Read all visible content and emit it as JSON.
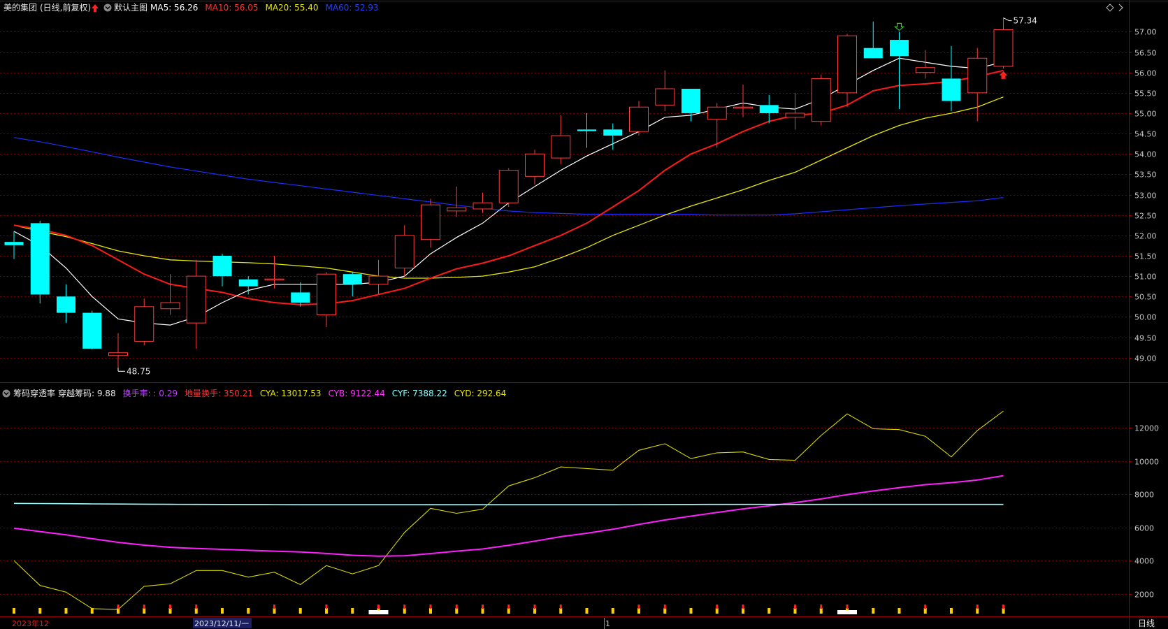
{
  "header": {
    "stock_name": "美的集团",
    "period": "(日线,前复权)",
    "template": "默认主图",
    "ma_items": [
      {
        "label": "MA5: 56.26",
        "color": "#ffffff"
      },
      {
        "label": "MA10: 56.05",
        "color": "#ff3030"
      },
      {
        "label": "MA20: 55.40",
        "color": "#e8e800"
      },
      {
        "label": "MA60: 52.93",
        "color": "#2040ff"
      }
    ]
  },
  "indicator_header": {
    "name": "筹码穿透率",
    "items": [
      {
        "label": "穿越筹码: 9.88",
        "color": "#e8e8e8"
      },
      {
        "label": "换手率: : 0.29",
        "color": "#c040ff"
      },
      {
        "label": "地量换手: 350.21",
        "color": "#ff3030"
      },
      {
        "label": "CYA: 13017.53",
        "color": "#e8e800"
      },
      {
        "label": "CYB: 9122.44",
        "color": "#ff30ff"
      },
      {
        "label": "CYF: 7388.22",
        "color": "#80ffff"
      },
      {
        "label": "CYD: 292.64",
        "color": "#e8e800"
      }
    ]
  },
  "bottom_axis": {
    "labels": [
      "2023年12",
      "2023/12/11/一",
      "1"
    ],
    "period_button": "日线"
  },
  "colors": {
    "up": "#ff3b3b",
    "down": "#00ffff",
    "ma5": "#ffffff",
    "ma10": "#ff1a1a",
    "ma20": "#e8e800",
    "ma60": "#1a2fff",
    "grid": "#7a0000",
    "cya": "#d8d800",
    "cyb": "#ff20ff",
    "cyf": "#a0ffff"
  },
  "chart_data": [
    {
      "type": "candlestick",
      "ylim": [
        48.6,
        57.35
      ],
      "yticks": [
        49.0,
        49.5,
        50.0,
        50.5,
        51.0,
        51.5,
        52.0,
        52.5,
        53.0,
        53.5,
        54.0,
        54.5,
        55.0,
        55.5,
        56.0,
        56.5,
        57.0
      ],
      "candles": [
        {
          "o": 51.84,
          "h": 52.1,
          "l": 51.42,
          "c": 51.76
        },
        {
          "o": 52.3,
          "h": 52.36,
          "l": 50.33,
          "c": 50.55
        },
        {
          "o": 50.5,
          "h": 50.8,
          "l": 49.85,
          "c": 50.1
        },
        {
          "o": 50.1,
          "h": 50.15,
          "l": 49.2,
          "c": 49.22
        },
        {
          "o": 49.05,
          "h": 49.6,
          "l": 48.75,
          "c": 49.12
        },
        {
          "o": 49.4,
          "h": 50.45,
          "l": 49.3,
          "c": 50.25
        },
        {
          "o": 50.2,
          "h": 51.05,
          "l": 50.05,
          "c": 50.35
        },
        {
          "o": 49.85,
          "h": 51.4,
          "l": 49.22,
          "c": 51.0
        },
        {
          "o": 51.5,
          "h": 51.55,
          "l": 50.75,
          "c": 51.0
        },
        {
          "o": 50.92,
          "h": 51.0,
          "l": 50.55,
          "c": 50.75
        },
        {
          "o": 50.93,
          "h": 51.5,
          "l": 50.7,
          "c": 50.93
        },
        {
          "o": 50.6,
          "h": 50.85,
          "l": 50.25,
          "c": 50.35
        },
        {
          "o": 50.05,
          "h": 51.1,
          "l": 49.75,
          "c": 51.05
        },
        {
          "o": 51.05,
          "h": 51.1,
          "l": 50.5,
          "c": 50.8
        },
        {
          "o": 50.8,
          "h": 51.4,
          "l": 50.55,
          "c": 51.0
        },
        {
          "o": 51.2,
          "h": 52.25,
          "l": 51.0,
          "c": 52.0
        },
        {
          "o": 51.9,
          "h": 52.9,
          "l": 51.7,
          "c": 52.75
        },
        {
          "o": 52.6,
          "h": 53.2,
          "l": 52.45,
          "c": 52.68
        },
        {
          "o": 52.65,
          "h": 53.05,
          "l": 52.55,
          "c": 52.8
        },
        {
          "o": 52.8,
          "h": 53.65,
          "l": 52.7,
          "c": 53.6
        },
        {
          "o": 53.45,
          "h": 54.1,
          "l": 53.25,
          "c": 54.0
        },
        {
          "o": 53.9,
          "h": 54.95,
          "l": 53.75,
          "c": 54.45
        },
        {
          "o": 54.6,
          "h": 55.0,
          "l": 54.15,
          "c": 54.56
        },
        {
          "o": 54.6,
          "h": 54.75,
          "l": 54.1,
          "c": 54.45
        },
        {
          "o": 54.55,
          "h": 55.3,
          "l": 54.45,
          "c": 55.15
        },
        {
          "o": 55.2,
          "h": 56.05,
          "l": 55.05,
          "c": 55.6
        },
        {
          "o": 55.6,
          "h": 55.6,
          "l": 54.8,
          "c": 55.0
        },
        {
          "o": 54.85,
          "h": 55.25,
          "l": 54.15,
          "c": 55.15
        },
        {
          "o": 55.15,
          "h": 55.7,
          "l": 54.9,
          "c": 55.15
        },
        {
          "o": 55.2,
          "h": 55.45,
          "l": 54.75,
          "c": 55.0
        },
        {
          "o": 54.9,
          "h": 55.5,
          "l": 54.6,
          "c": 55.0
        },
        {
          "o": 54.8,
          "h": 55.95,
          "l": 54.7,
          "c": 55.85
        },
        {
          "o": 55.5,
          "h": 56.95,
          "l": 55.15,
          "c": 56.9
        },
        {
          "o": 56.6,
          "h": 57.25,
          "l": 56.35,
          "c": 56.35
        },
        {
          "o": 56.8,
          "h": 57.0,
          "l": 55.1,
          "c": 56.4
        },
        {
          "o": 56.0,
          "h": 56.55,
          "l": 55.85,
          "c": 56.12
        },
        {
          "o": 55.85,
          "h": 56.65,
          "l": 55.05,
          "c": 55.3
        },
        {
          "o": 55.5,
          "h": 56.6,
          "l": 54.8,
          "c": 56.35
        },
        {
          "o": 56.15,
          "h": 57.34,
          "l": 56.1,
          "c": 57.05
        }
      ],
      "ma5": [
        52.1,
        51.75,
        51.2,
        50.5,
        49.95,
        49.85,
        49.8,
        50.0,
        50.35,
        50.65,
        50.8,
        50.8,
        50.8,
        50.8,
        50.85,
        51.0,
        51.55,
        51.95,
        52.3,
        52.8,
        53.2,
        53.6,
        53.95,
        54.25,
        54.55,
        54.9,
        54.95,
        55.1,
        55.25,
        55.15,
        55.1,
        55.35,
        55.7,
        56.05,
        56.35,
        56.25,
        56.15,
        56.1,
        56.26
      ],
      "ma10": [
        52.25,
        52.15,
        52.0,
        51.75,
        51.4,
        51.05,
        50.8,
        50.7,
        50.6,
        50.45,
        50.35,
        50.3,
        50.32,
        50.4,
        50.55,
        50.7,
        50.95,
        51.18,
        51.32,
        51.5,
        51.75,
        52.0,
        52.3,
        52.7,
        53.1,
        53.6,
        54.0,
        54.25,
        54.55,
        54.8,
        54.95,
        55.0,
        55.2,
        55.55,
        55.68,
        55.72,
        55.78,
        55.9,
        56.05
      ],
      "ma20": [
        52.25,
        52.1,
        51.97,
        51.8,
        51.62,
        51.5,
        51.4,
        51.37,
        51.35,
        51.33,
        51.3,
        51.25,
        51.2,
        51.1,
        51.0,
        50.95,
        50.95,
        50.97,
        51.0,
        51.1,
        51.23,
        51.45,
        51.7,
        52.0,
        52.25,
        52.5,
        52.72,
        52.92,
        53.12,
        53.35,
        53.55,
        53.85,
        54.15,
        54.45,
        54.7,
        54.88,
        55.0,
        55.15,
        55.4
      ],
      "ma60": [
        54.4,
        54.3,
        54.18,
        54.05,
        53.92,
        53.8,
        53.68,
        53.58,
        53.48,
        53.38,
        53.3,
        53.22,
        53.14,
        53.06,
        52.98,
        52.9,
        52.82,
        52.74,
        52.67,
        52.6,
        52.56,
        52.54,
        52.52,
        52.52,
        52.52,
        52.52,
        52.52,
        52.5,
        52.5,
        52.5,
        52.53,
        52.58,
        52.63,
        52.68,
        52.73,
        52.77,
        52.81,
        52.85,
        52.93
      ],
      "annotations": [
        {
          "label": "48.75",
          "candle": 4,
          "value": 48.75
        },
        {
          "label": "57.34",
          "candle": 38,
          "value": 57.34
        }
      ],
      "signals": [
        {
          "candle": 34,
          "kind": "down-arrow",
          "color": "#33cc33"
        },
        {
          "candle": 38,
          "kind": "up-arrow",
          "color": "#ff2020"
        }
      ]
    },
    {
      "type": "line",
      "ylim": [
        800,
        13700
      ],
      "yticks": [
        2000,
        4000,
        6000,
        8000,
        10000,
        12000
      ],
      "series": [
        {
          "name": "CYA",
          "values": [
            4000,
            2500,
            2100,
            1100,
            1050,
            2450,
            2600,
            3400,
            3400,
            3000,
            3300,
            2550,
            3700,
            3200,
            3700,
            5700,
            7150,
            6850,
            7100,
            8500,
            9000,
            9650,
            9550,
            9450,
            10650,
            11050,
            10150,
            10500,
            10550,
            10100,
            10050,
            11550,
            12850,
            11950,
            11900,
            11500,
            10250,
            11850,
            13017.53
          ]
        },
        {
          "name": "CYB",
          "values": [
            5950,
            5750,
            5550,
            5320,
            5100,
            4930,
            4800,
            4730,
            4680,
            4620,
            4570,
            4520,
            4430,
            4320,
            4270,
            4290,
            4420,
            4570,
            4700,
            4920,
            5170,
            5440,
            5650,
            5890,
            6180,
            6450,
            6680,
            6900,
            7120,
            7300,
            7500,
            7720,
            7980,
            8200,
            8400,
            8580,
            8700,
            8860,
            9122.44
          ]
        },
        {
          "name": "CYF",
          "values": [
            7450,
            7440,
            7430,
            7420,
            7410,
            7400,
            7395,
            7390,
            7385,
            7380,
            7375,
            7370,
            7370,
            7370,
            7370,
            7370,
            7370,
            7370,
            7370,
            7370,
            7370,
            7370,
            7370,
            7370,
            7375,
            7380,
            7385,
            7388,
            7390,
            7390,
            7390,
            7390,
            7390,
            7390,
            7390,
            7390,
            7390,
            7390,
            7388.22
          ]
        }
      ]
    }
  ]
}
